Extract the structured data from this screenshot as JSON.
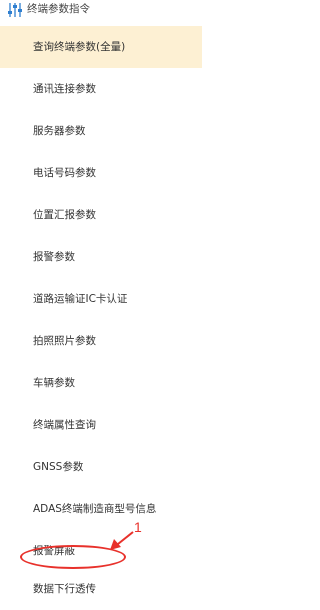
{
  "header": {
    "icon": "sliders-icon",
    "label": "终端参数指令"
  },
  "menu": {
    "items": [
      {
        "label": "查询终端参数(全量)",
        "active": true
      },
      {
        "label": "通讯连接参数",
        "active": false
      },
      {
        "label": "服务器参数",
        "active": false
      },
      {
        "label": "电话号码参数",
        "active": false
      },
      {
        "label": "位置汇报参数",
        "active": false
      },
      {
        "label": "报警参数",
        "active": false
      },
      {
        "label": "道路运输证IC卡认证",
        "active": false
      },
      {
        "label": "拍照照片参数",
        "active": false
      },
      {
        "label": "车辆参数",
        "active": false
      },
      {
        "label": "终端属性查询",
        "active": false
      },
      {
        "label": "GNSS参数",
        "active": false
      },
      {
        "label": "ADAS终端制造商型号信息",
        "active": false
      },
      {
        "label": "报警屏蔽",
        "active": false
      },
      {
        "label": "数据下行透传",
        "active": false
      }
    ]
  },
  "annotation": {
    "number": "1",
    "color": "#e8312b"
  },
  "colors": {
    "active_background": "#fdf0d3",
    "icon_blue": "#2f7fd0"
  }
}
